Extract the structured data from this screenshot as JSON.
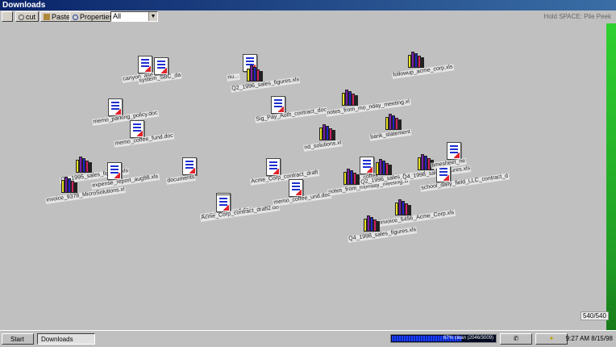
{
  "window": {
    "title": "Downloads"
  },
  "toolbar": {
    "cut_label": "cut",
    "paste_label": "Paste",
    "properties_label": "Properties",
    "filter_value": "All",
    "hint": "Hold SPACE: Pile Peek"
  },
  "counter": "540/540",
  "files": [
    {
      "label": "canyon_ase_inn",
      "icon": "doc"
    },
    {
      "label": "system_SBC_da",
      "icon": "doc"
    },
    {
      "label": "followup_acme_corp.xls",
      "icon": "books"
    },
    {
      "label": "nu...",
      "icon": "doc"
    },
    {
      "label": "Q2_1996_sales_figures.xls",
      "icon": "books"
    },
    {
      "label": "memo_parking_policy.doc",
      "icon": "doc"
    },
    {
      "label": "Sig_Pay_Auth_contract_doc",
      "icon": "doc"
    },
    {
      "label": "notes_from_mo_nday_meeting.xl",
      "icon": "books"
    },
    {
      "label": "bank_statement",
      "icon": "books"
    },
    {
      "label": "memo_coffee",
      "icon": "doc"
    },
    {
      "label": "Q1_1995_sales_figures.xls",
      "icon": "books"
    },
    {
      "label": "invoice_9378_MicroSolutions.xl",
      "icon": "books"
    },
    {
      "label": "expense_report_aug98.xls",
      "icon": "doc"
    },
    {
      "label": "documents",
      "icon": "doc"
    },
    {
      "label": "Acme_Corp_contract_draft",
      "icon": "doc"
    },
    {
      "label": "memo_coffee_fund.doc",
      "icon": "doc"
    },
    {
      "label": "notes_from_monday_meeting.xl",
      "icon": "books"
    },
    {
      "label": "Q2_1996_sales_figures.xls",
      "icon": "books"
    },
    {
      "label": "Q4_1998_sales_figures.xls",
      "icon": "books"
    },
    {
      "label": "school_daily_field_LLC_contract_d",
      "icon": "doc"
    },
    {
      "label": "timesheet_ne",
      "icon": "doc"
    },
    {
      "label": "invoice_5456_Acme_Corp.xls",
      "icon": "books"
    },
    {
      "label": "Q4_1998_sales_figures.xls",
      "icon": "books"
    },
    {
      "label": "memo_sea_und.doc",
      "icon": "doc"
    },
    {
      "label": "Acme_Corp_contract_draft2.do",
      "icon": "doc"
    },
    {
      "label": "memo_coffee_und.doc",
      "icon": "doc"
    },
    {
      "label": "nd_solutions.xl",
      "icon": "books"
    }
  ],
  "taskbar": {
    "start_label": "Start",
    "task_label": "Downloads",
    "progress_text": "67% clean (2046/3009)",
    "progress_fraction": 0.67,
    "clock": "9:27 AM 8/15/98"
  }
}
